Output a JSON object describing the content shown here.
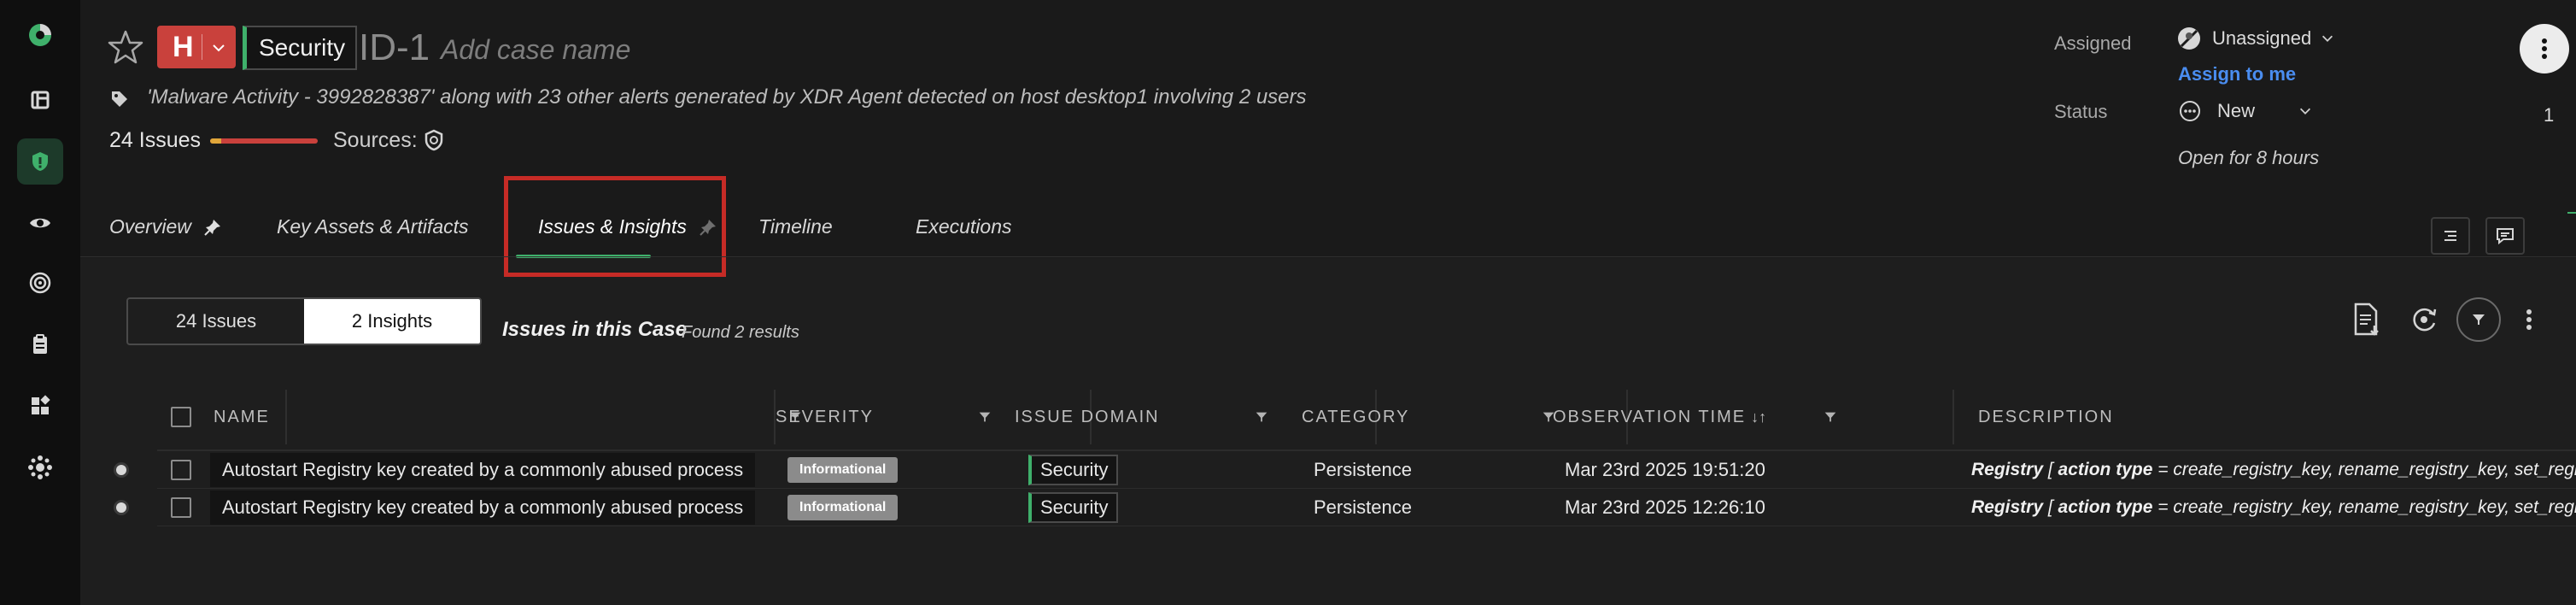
{
  "header": {
    "severity_letter": "H",
    "domain": "Security",
    "case_id": "ID-1",
    "case_name_placeholder": "Add case name",
    "description": "'Malware Activity - 3992828387' along with 23 other alerts generated by XDR Agent detected on host desktop1 involving 2 users",
    "issues_count": "24 Issues",
    "sources_label": "Sources:",
    "assigned_label": "Assigned",
    "assignee": "Unassigned",
    "assign_to_me": "Assign to me",
    "status_label": "Status",
    "status_value": "New",
    "open_for": "Open for 8 hours",
    "counter": "1"
  },
  "tabs": [
    {
      "label": "Overview"
    },
    {
      "label": "Key Assets & Artifacts"
    },
    {
      "label": "Issues & Insights"
    },
    {
      "label": "Timeline"
    },
    {
      "label": "Executions"
    }
  ],
  "content": {
    "segment": [
      "24 Issues",
      "2 Insights"
    ],
    "title": "Issues in this Case",
    "subtitle": "Found 2 results"
  },
  "table": {
    "columns": [
      "NAME",
      "SEVERITY",
      "ISSUE DOMAIN",
      "CATEGORY",
      "OBSERVATION TIME",
      "DESCRIPTION"
    ],
    "rows": [
      {
        "name": "Autostart Registry key created by a commonly abused process",
        "severity": "Informational",
        "domain": "Security",
        "category": "Persistence",
        "time": "Mar 23rd 2025 19:51:20",
        "desc_registry": "Registry",
        "desc_bracket": " [ ",
        "desc_field": "action type",
        "desc_rest": " = create_registry_key, rename_registry_key, set_registry_value AND"
      },
      {
        "name": "Autostart Registry key created by a commonly abused process",
        "severity": "Informational",
        "domain": "Security",
        "category": "Persistence",
        "time": "Mar 23rd 2025 12:26:10",
        "desc_registry": "Registry",
        "desc_bracket": " [ ",
        "desc_field": "action type",
        "desc_rest": " = create_registry_key, rename_registry_key, set_registry_value AND"
      }
    ]
  },
  "colors": {
    "accent_green": "#3fb06b",
    "severity_high": "#c9413c",
    "link_blue": "#4a8df0",
    "highlight_red": "#c62b26"
  }
}
